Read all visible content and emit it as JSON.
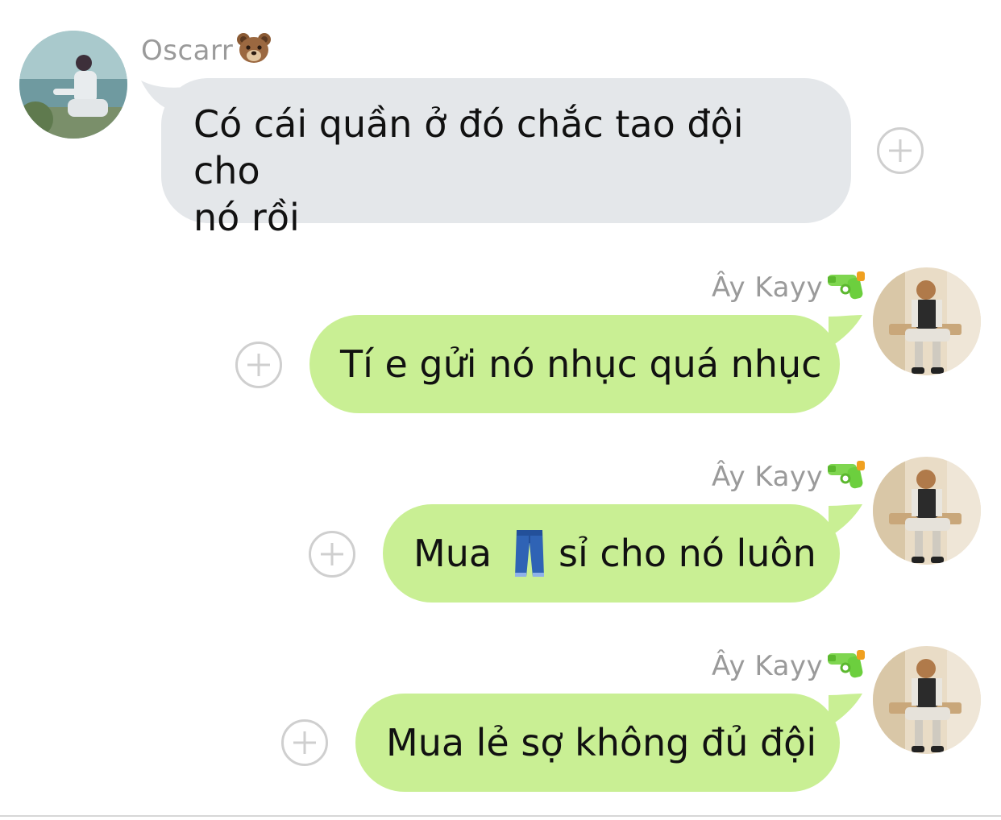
{
  "messages": [
    {
      "direction": "incoming",
      "sender": "Oscarr",
      "sender_emoji": "bear-face-emoji",
      "lines": [
        "Có cái quần ở đó chắc tao đội cho",
        "nó rồi"
      ]
    },
    {
      "direction": "outgoing",
      "sender": "Ây Kayy",
      "sender_emoji": "water-pistol-emoji",
      "text": "Tí e gửi nó nhục quá nhục"
    },
    {
      "direction": "outgoing",
      "sender": "Ây Kayy",
      "sender_emoji": "water-pistol-emoji",
      "text_before": "Mua",
      "inline_emoji": "jeans-emoji",
      "text_after": "sỉ cho nó luôn"
    },
    {
      "direction": "outgoing",
      "sender": "Ây Kayy",
      "sender_emoji": "water-pistol-emoji",
      "text": "Mua lẻ sợ không đủ đội"
    }
  ],
  "colors": {
    "incoming_bubble": "#e4e7ea",
    "outgoing_bubble": "#c9ef94",
    "sender_name": "#9a9a9a",
    "plus_button": "#cfcfcf"
  },
  "icons": {
    "reaction_button": "plus-circle-icon"
  }
}
